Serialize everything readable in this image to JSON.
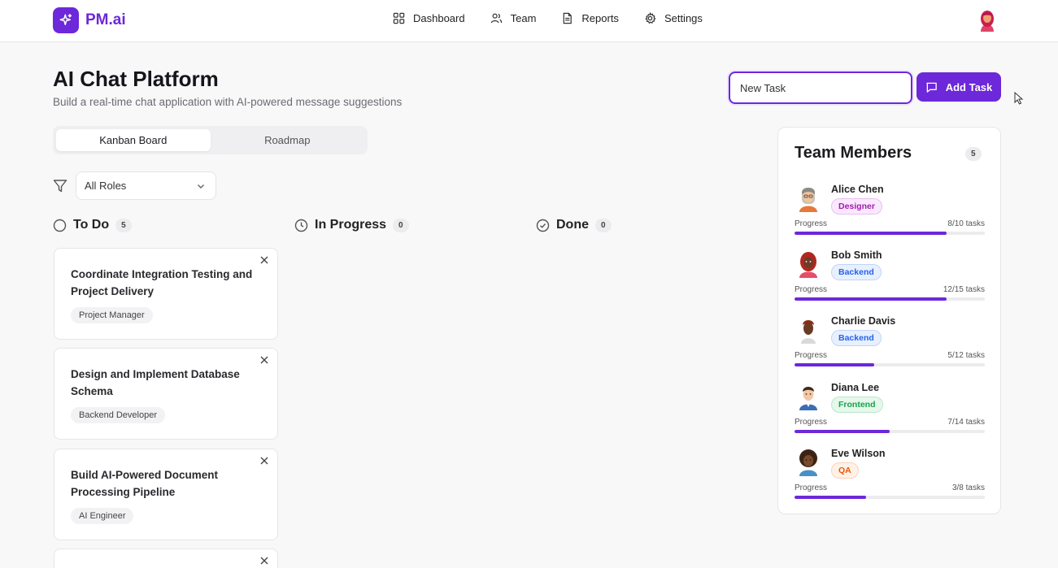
{
  "app": {
    "name": "PM.ai"
  },
  "nav": [
    {
      "label": "Dashboard",
      "icon": "grid-icon"
    },
    {
      "label": "Team",
      "icon": "users-icon"
    },
    {
      "label": "Reports",
      "icon": "document-icon"
    },
    {
      "label": "Settings",
      "icon": "gear-icon"
    }
  ],
  "project": {
    "title": "AI Chat Platform",
    "subtitle": "Build a real-time chat application with AI-powered message suggestions"
  },
  "new_task": {
    "value": "New Task",
    "button_label": "Add Task"
  },
  "tabs": [
    {
      "label": "Kanban Board",
      "active": true
    },
    {
      "label": "Roadmap",
      "active": false
    }
  ],
  "filter": {
    "selected": "All Roles"
  },
  "columns": [
    {
      "title": "To Do",
      "count": "5",
      "icon": "circle-icon"
    },
    {
      "title": "In Progress",
      "count": "0",
      "icon": "clock-icon"
    },
    {
      "title": "Done",
      "count": "0",
      "icon": "check-circle-icon"
    }
  ],
  "tasks": [
    {
      "title": "Coordinate Integration Testing and Project Delivery",
      "role": "Project Manager"
    },
    {
      "title": "Design and Implement Database Schema",
      "role": "Backend Developer"
    },
    {
      "title": "Build AI-Powered Document Processing Pipeline",
      "role": "AI Engineer"
    },
    {
      "title": "",
      "role": ""
    }
  ],
  "team": {
    "title": "Team Members",
    "count": "5",
    "progress_label": "Progress",
    "members": [
      {
        "name": "Alice Chen",
        "role": "Designer",
        "progress_text": "8/10 tasks",
        "progress": 0.8,
        "badge_color": "#a21caf",
        "badge_bg": "#fae8ff"
      },
      {
        "name": "Bob Smith",
        "role": "Backend",
        "progress_text": "12/15 tasks",
        "progress": 0.8,
        "badge_color": "#2563eb",
        "badge_bg": "#e8f0fe"
      },
      {
        "name": "Charlie Davis",
        "role": "Backend",
        "progress_text": "5/12 tasks",
        "progress": 0.4167,
        "badge_color": "#2563eb",
        "badge_bg": "#e8f0fe"
      },
      {
        "name": "Diana Lee",
        "role": "Frontend",
        "progress_text": "7/14 tasks",
        "progress": 0.5,
        "badge_color": "#16a34a",
        "badge_bg": "#e6f7ec"
      },
      {
        "name": "Eve Wilson",
        "role": "QA",
        "progress_text": "3/8 tasks",
        "progress": 0.375,
        "badge_color": "#ea580c",
        "badge_bg": "#fff1e6"
      }
    ]
  },
  "colors": {
    "accent": "#6d28d9"
  }
}
